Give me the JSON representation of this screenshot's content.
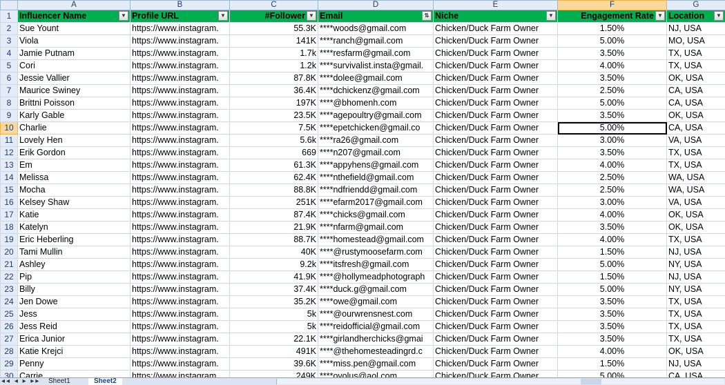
{
  "columns": [
    "A",
    "B",
    "C",
    "D",
    "E",
    "F",
    "G"
  ],
  "headers": [
    "Influencer Name",
    "Profile URL",
    "#Follower",
    "Email",
    "Niche",
    "Engagement Rate",
    "Location"
  ],
  "selected": {
    "row": 10,
    "col": "F"
  },
  "rows": [
    [
      "Sue Yount",
      "https://www.instagram.",
      "55.3K",
      "****woods@gmail.com",
      "Chicken/Duck Farm Owner",
      "1.50%",
      "NJ, USA"
    ],
    [
      "Viola",
      "https://www.instagram.",
      "141K",
      "****ranch@gmail.com",
      "Chicken/Duck Farm Owner",
      "5.00%",
      "MO, USA"
    ],
    [
      "Jamie Putnam",
      "https://www.instagram.",
      "1.7k",
      "****resfarm@gmail.com",
      "Chicken/Duck Farm Owner",
      "3.50%",
      "TX, USA"
    ],
    [
      "Cori",
      "https://www.instagram.",
      "1.2k",
      "****survivalist.insta@gmail.",
      "Chicken/Duck Farm Owner",
      "4.00%",
      "TX, USA"
    ],
    [
      "Jessie Vallier",
      "https://www.instagram.",
      "87.8K",
      "****dolee@gmail.com",
      "Chicken/Duck Farm Owner",
      "3.50%",
      "OK, USA"
    ],
    [
      "Maurice Swiney",
      "https://www.instagram.",
      "36.4K",
      "****dchickenz@gmail.com",
      "Chicken/Duck Farm Owner",
      "2.50%",
      "CA, USA"
    ],
    [
      "Brittni Poisson",
      "https://www.instagram.",
      "197K",
      "****@bhomenh.com",
      "Chicken/Duck Farm Owner",
      "5.00%",
      "CA, USA"
    ],
    [
      "Karly Gable",
      "https://www.instagram.",
      "23.5K",
      "****agepoultry@gmail.com",
      "Chicken/Duck Farm Owner",
      "3.50%",
      "OK, USA"
    ],
    [
      "Charlie",
      "https://www.instagram.",
      "7.5K",
      "****epetchicken@gmail.co",
      "Chicken/Duck Farm Owner",
      "5.00%",
      "CA, USA"
    ],
    [
      "Lovely Hen",
      "https://www.instagram.",
      "5.6k",
      "****ra26@gmail.com",
      "Chicken/Duck Farm Owner",
      "3.00%",
      "VA, USA"
    ],
    [
      "Erik Gordon",
      "https://www.instagram.",
      "669",
      "****n207@gmail.com",
      "Chicken/Duck Farm Owner",
      "3.50%",
      "TX, USA"
    ],
    [
      "Em",
      "https://www.instagram.",
      "61.3K",
      "****appyhens@gmail.com",
      "Chicken/Duck Farm Owner",
      "4.00%",
      "TX, USA"
    ],
    [
      "Melissa",
      "https://www.instagram.",
      "62.4K",
      "****nthefield@gmail.com",
      "Chicken/Duck Farm Owner",
      "2.50%",
      "WA, USA"
    ],
    [
      "Mocha",
      "https://www.instagram.",
      "88.8K",
      "****ndfriendd@gmail.com",
      "Chicken/Duck Farm Owner",
      "2.50%",
      "WA, USA"
    ],
    [
      "Kelsey Shaw",
      "https://www.instagram.",
      "251K",
      "****efarm2017@gmail.com",
      "Chicken/Duck Farm Owner",
      "3.00%",
      "VA, USA"
    ],
    [
      "Katie",
      "https://www.instagram.",
      "87.4K",
      "****chicks@gmail.com",
      "Chicken/Duck Farm Owner",
      "4.00%",
      "OK, USA"
    ],
    [
      "Katelyn",
      "https://www.instagram.",
      "21.9K",
      "****nfarm@gmail.com",
      "Chicken/Duck Farm Owner",
      "3.50%",
      "OK, USA"
    ],
    [
      "Eric Heberling",
      "https://www.instagram.",
      "88.7K",
      "****homestead@gmail.com",
      "Chicken/Duck Farm Owner",
      "4.00%",
      "TX, USA"
    ],
    [
      "Tami Mullin",
      "https://www.instagram.",
      "40K",
      "****@rustymoosefarm.com",
      "Chicken/Duck Farm Owner",
      "1.50%",
      "NJ, USA"
    ],
    [
      "Ashley",
      "https://www.instagram.",
      "9.2k",
      "****itsfresh@gmail.com",
      "Chicken/Duck Farm Owner",
      "5.00%",
      "NY, USA"
    ],
    [
      "Pip",
      "https://www.instagram.",
      "41.9K",
      "****@hollymeadphotograph",
      "Chicken/Duck Farm Owner",
      "1.50%",
      "NJ, USA"
    ],
    [
      "Billy",
      "https://www.instagram.",
      "37.4K",
      "****duck.g@gmail.com",
      "Chicken/Duck Farm Owner",
      "5.00%",
      "NY, USA"
    ],
    [
      "Jen Dowe",
      "https://www.instagram.",
      "35.2K",
      "****owe@gmail.com",
      "Chicken/Duck Farm Owner",
      "3.50%",
      "TX, USA"
    ],
    [
      "Jess",
      "https://www.instagram.",
      "5k",
      "****@ourwrensnest.com",
      "Chicken/Duck Farm Owner",
      "3.50%",
      "TX, USA"
    ],
    [
      "Jess Reid",
      "https://www.instagram.",
      "5k",
      "****reidofficial@gmail.com",
      "Chicken/Duck Farm Owner",
      "3.50%",
      "TX, USA"
    ],
    [
      "Erica Junior",
      "https://www.instagram.",
      "22.1K",
      "****girlandherchicks@gmai",
      "Chicken/Duck Farm Owner",
      "3.50%",
      "TX, USA"
    ],
    [
      "Katie Krejci",
      "https://www.instagram.",
      "491K",
      "****@thehomesteadingrd.c",
      "Chicken/Duck Farm Owner",
      "4.00%",
      "OK, USA"
    ],
    [
      "Penny",
      "https://www.instagram.",
      "39.6K",
      "****miss.pen@gmail.com",
      "Chicken/Duck Farm Owner",
      "1.50%",
      "NJ, USA"
    ],
    [
      "Carrie",
      "https://www.instagram.",
      "249K",
      "****ovolus@aol.com",
      "Chicken/Duck Farm Owner",
      "5.00%",
      "CA, USA"
    ]
  ],
  "sheet_tabs": [
    "Sheet1",
    "Sheet2"
  ],
  "active_tab": "Sheet2",
  "colors": {
    "header_fill": "#00b050",
    "selection_highlight": "#f9d99b",
    "grid": "#d0d7e5"
  }
}
